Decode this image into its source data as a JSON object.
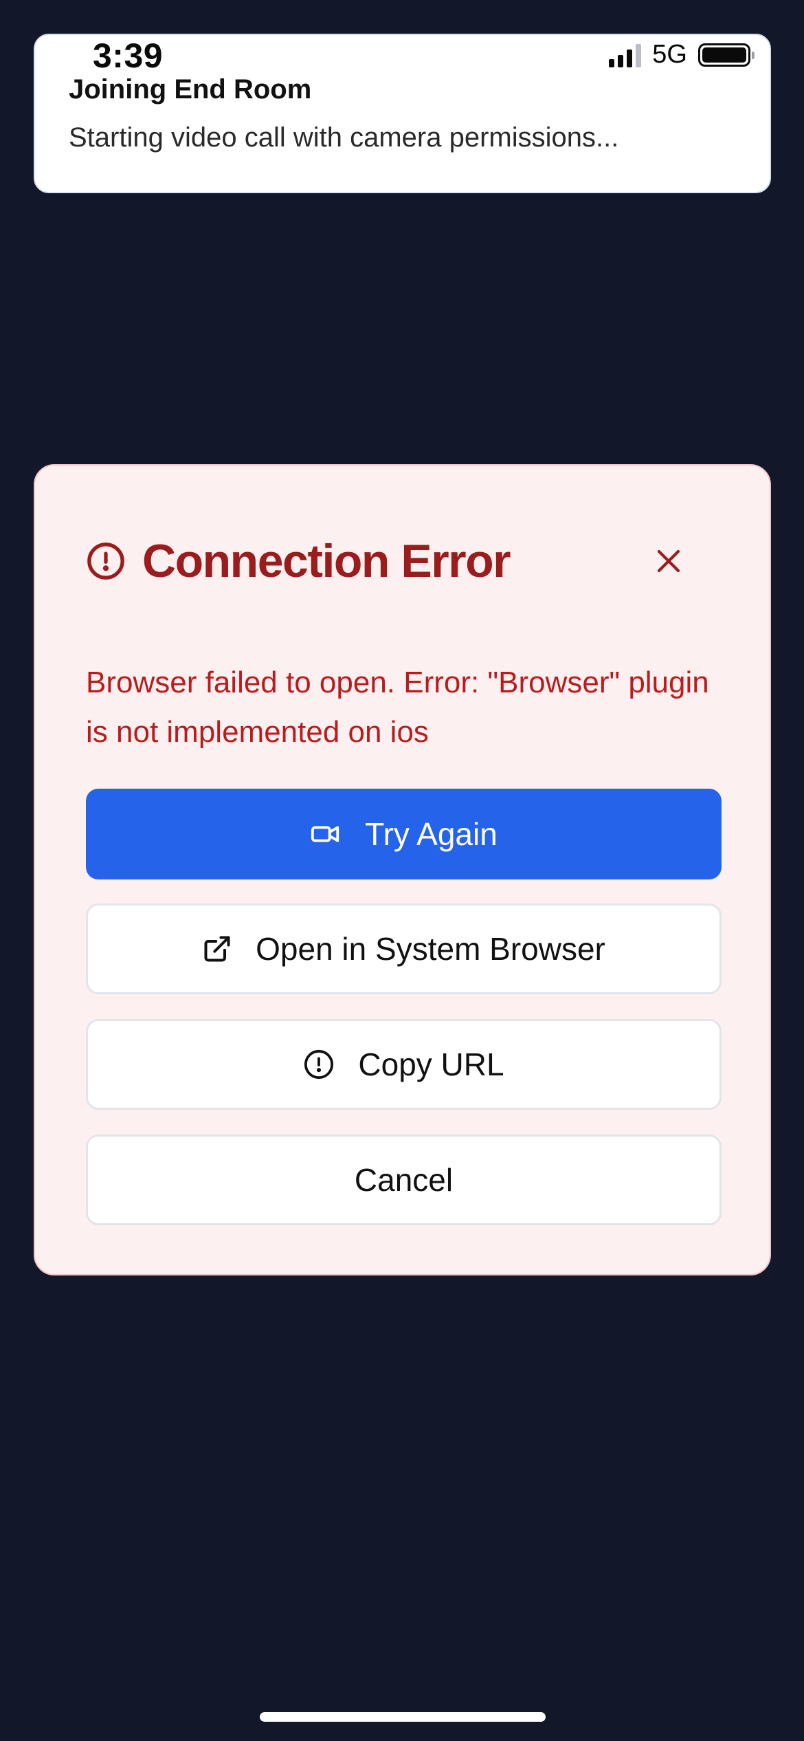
{
  "status_bar": {
    "time": "3:39",
    "network": "5G",
    "icons": [
      "signal-icon",
      "battery-icon"
    ]
  },
  "notification": {
    "title": "Joining End Room",
    "body": "Starting video call with camera permissions..."
  },
  "dialog": {
    "title": "Connection Error",
    "title_icon": "alert-circle-icon",
    "close_icon": "close-icon",
    "message": "Browser failed to open. Error: \"Browser\" plugin is not implemented on ios",
    "buttons": {
      "try_again": {
        "label": "Try Again",
        "icon": "video-camera-icon"
      },
      "open_browser": {
        "label": "Open in System Browser",
        "icon": "external-link-icon"
      },
      "copy_url": {
        "label": "Copy URL",
        "icon": "alert-circle-icon"
      },
      "cancel": {
        "label": "Cancel"
      }
    }
  },
  "colors": {
    "background": "#121829",
    "dialog_bg": "#fdf0f0",
    "error_red": "#9b1c1c",
    "message_red": "#b91c1c",
    "primary_blue": "#2563eb"
  }
}
